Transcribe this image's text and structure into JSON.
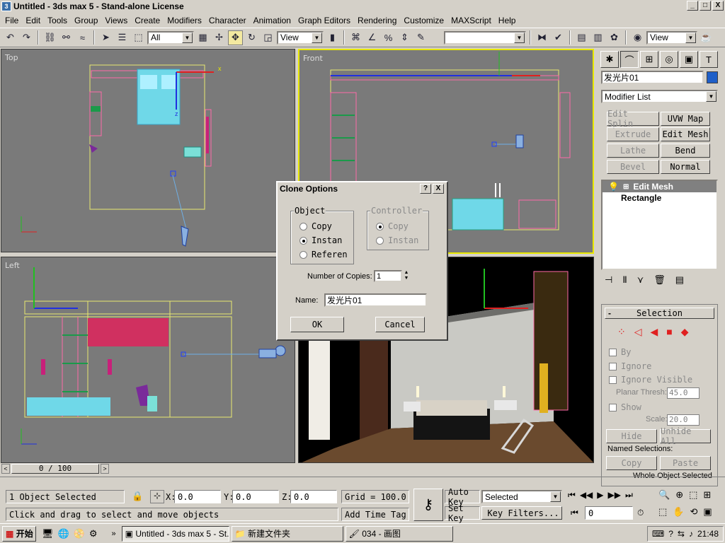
{
  "window": {
    "title": "Untitled - 3ds max 5 - Stand-alone License",
    "app_icon": "3ds-max-icon",
    "buttons": [
      "_",
      "□",
      "X"
    ]
  },
  "menu": [
    "File",
    "Edit",
    "Tools",
    "Group",
    "Views",
    "Create",
    "Modifiers",
    "Character",
    "Animation",
    "Graph Editors",
    "Rendering",
    "Customize",
    "MAXScript",
    "Help"
  ],
  "toolbar": {
    "selection_filter": "All",
    "ref_coord": "View",
    "named_selection": "",
    "render_view": "View"
  },
  "viewports": {
    "top": "Top",
    "front": "Front",
    "left": "Left",
    "perspective": ""
  },
  "command_panel": {
    "object_name": "发光片01",
    "object_color": "#1f5fc8",
    "modifier_list": "Modifier List",
    "modifier_buttons": [
      {
        "label": "Edit Splin",
        "enabled": false
      },
      {
        "label": "UVW Map",
        "enabled": true
      },
      {
        "label": "Extrude",
        "enabled": false
      },
      {
        "label": "Edit Mesh",
        "enabled": true
      },
      {
        "label": "Lathe",
        "enabled": false
      },
      {
        "label": "Bend",
        "enabled": true
      },
      {
        "label": "Bevel",
        "enabled": false
      },
      {
        "label": "Normal",
        "enabled": true
      }
    ],
    "stack": [
      "Edit Mesh",
      "Rectangle"
    ],
    "selection": {
      "header": "Selection",
      "by": "By",
      "ignore": "Ignore",
      "ignore_visible": "Ignore Visible",
      "planar_thresh_label": "Planar Thresh:",
      "planar_thresh": "45.0",
      "show": "Show",
      "scale_label": "Scale:",
      "scale": "20.0",
      "hide": "Hide",
      "unhide_all": "Unhide All",
      "named_selections": "Named Selections:",
      "copy": "Copy",
      "paste": "Paste",
      "whole_object": "Whole Object Selected"
    }
  },
  "dialog": {
    "title": "Clone Options",
    "object_group": "Object",
    "object_options": [
      "Copy",
      "Instan",
      "Referen"
    ],
    "object_selected": 1,
    "controller_group": "Controller",
    "controller_options": [
      "Copy",
      "Instan"
    ],
    "copies_label": "Number of Copies:",
    "copies": "1",
    "name_label": "Name:",
    "name": "发光片01",
    "ok": "OK",
    "cancel": "Cancel"
  },
  "timeline": {
    "frame": "0 / 100"
  },
  "status": {
    "selected": "1 Object Selected",
    "x_label": "X:",
    "x": "0.0",
    "y_label": "Y:",
    "y": "0.0",
    "z_label": "Z:",
    "z": "0.0",
    "grid": "Grid = 100.0",
    "prompt": "Click and drag to select and move objects",
    "add_time_tag": "Add Time Tag",
    "auto_key": "Auto Key",
    "set_key": "Set Key",
    "key_mode": "Selected",
    "key_filters": "Key Filters...",
    "current_frame": "0"
  },
  "taskbar": {
    "start": "开始",
    "tasks": [
      "Untitled - 3ds max 5 - St...",
      "新建文件夹",
      "034 - 画图"
    ],
    "active_task": 0,
    "clock": "21:48"
  }
}
